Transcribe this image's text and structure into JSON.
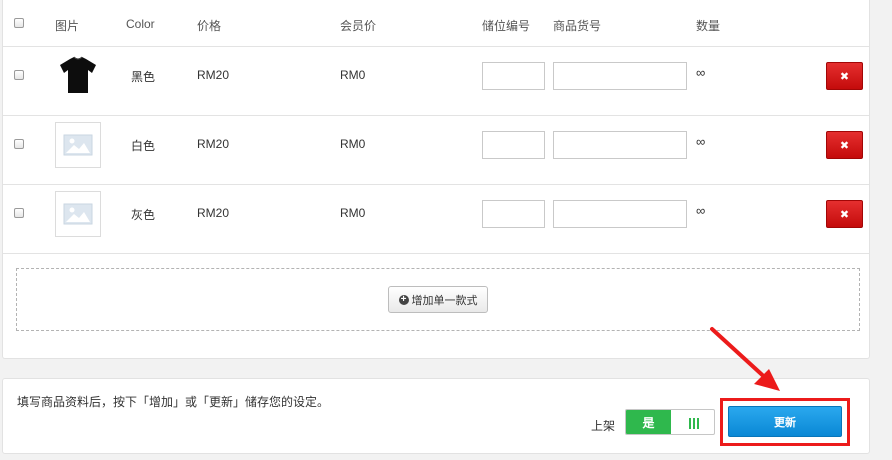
{
  "table": {
    "headers": {
      "image": "图片",
      "color": "Color",
      "price": "价格",
      "member_price": "会员价",
      "location_code": "储位编号",
      "sku": "商品货号",
      "quantity": "数量"
    },
    "rows": [
      {
        "color": "黑色",
        "price": "RM20",
        "member_price": "RM0",
        "quantity": "∞",
        "image": "black-tshirt"
      },
      {
        "color": "白色",
        "price": "RM20",
        "member_price": "RM0",
        "quantity": "∞",
        "image": "image-placeholder"
      },
      {
        "color": "灰色",
        "price": "RM20",
        "member_price": "RM0",
        "quantity": "∞",
        "image": "image-placeholder"
      }
    ],
    "delete_icon": "✖",
    "add_variant_label": "增加单一款式"
  },
  "footer": {
    "hint": "填写商品资料后，按下「增加」或「更新」储存您的设定。",
    "publish_label": "上架",
    "publish_toggle_on": "是",
    "update_label": "更新"
  },
  "colors": {
    "delete": "#d21414",
    "update": "#1596e2",
    "toggle_on": "#2fb84d",
    "annotation": "#ec1b1b"
  }
}
